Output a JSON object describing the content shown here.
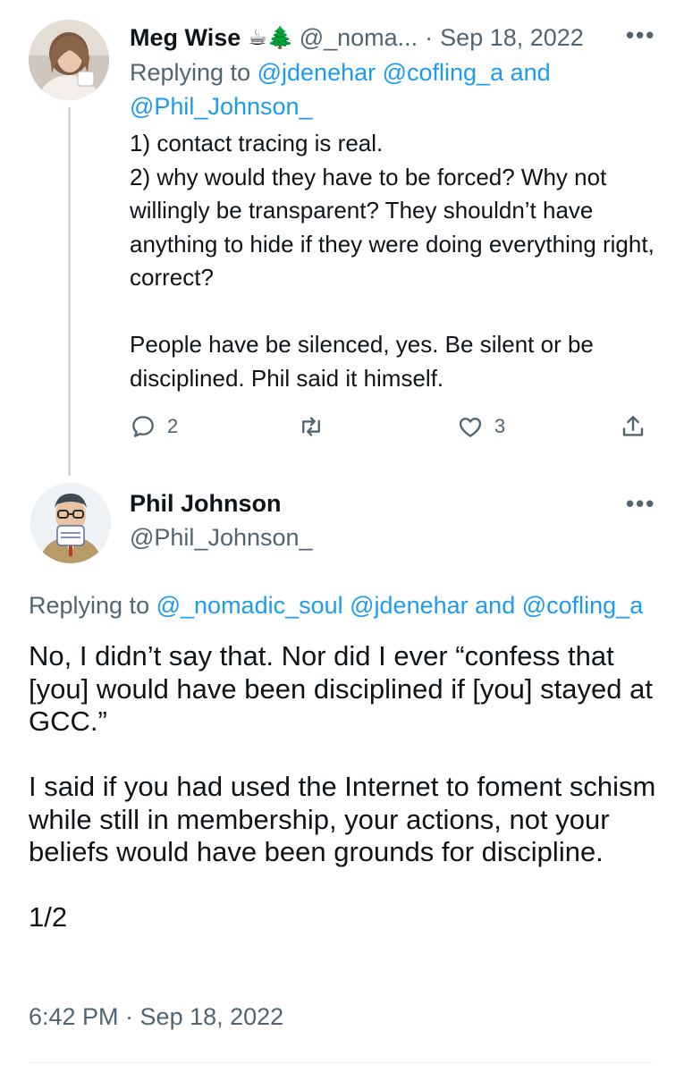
{
  "reply_tweet": {
    "author_name": "Meg Wise",
    "author_emoji": "☕🌲",
    "author_handle": "@_noma...",
    "separator": "·",
    "date": "Sep 18, 2022",
    "replying_prefix": "Replying to",
    "replying_mentions_line1": "@jdenehar @cofling_a",
    "replying_and": "and",
    "replying_mentions_line2": "@Phil_Johnson_",
    "text": "1) contact tracing is real.\n2) why would they have to be forced? Why not willingly be transparent? They shouldn’t have anything to hide if they were doing everything right, correct?\n\nPeople have be silenced, yes. Be silent or be disciplined. Phil said it himself.",
    "reply_count": "2",
    "like_count": "3",
    "icons": [
      "reply-icon",
      "retweet-icon",
      "like-icon",
      "share-icon",
      "more-icon"
    ]
  },
  "main_tweet": {
    "author_name": "Phil Johnson",
    "author_handle": "@Phil_Johnson_",
    "replying_prefix": "Replying to",
    "replying_mention_1": "@_nomadic_soul @jdenehar",
    "replying_and": "and",
    "replying_mention_2": "@cofling_a",
    "text": "No, I didn’t say that. Nor did I ever “confess that [you] would have been disciplined if [you] stayed at GCC.”\n\nI said if you had used the Internet to foment schism while still in membership, your actions, not your beliefs would have been grounds for discipline.\n\n1/2",
    "timestamp": "6:42 PM · Sep 18, 2022"
  },
  "colors": {
    "text": "#0f1419",
    "secondary": "#536471",
    "link": "#1d9bf0",
    "thread_line": "#cfd9de"
  }
}
